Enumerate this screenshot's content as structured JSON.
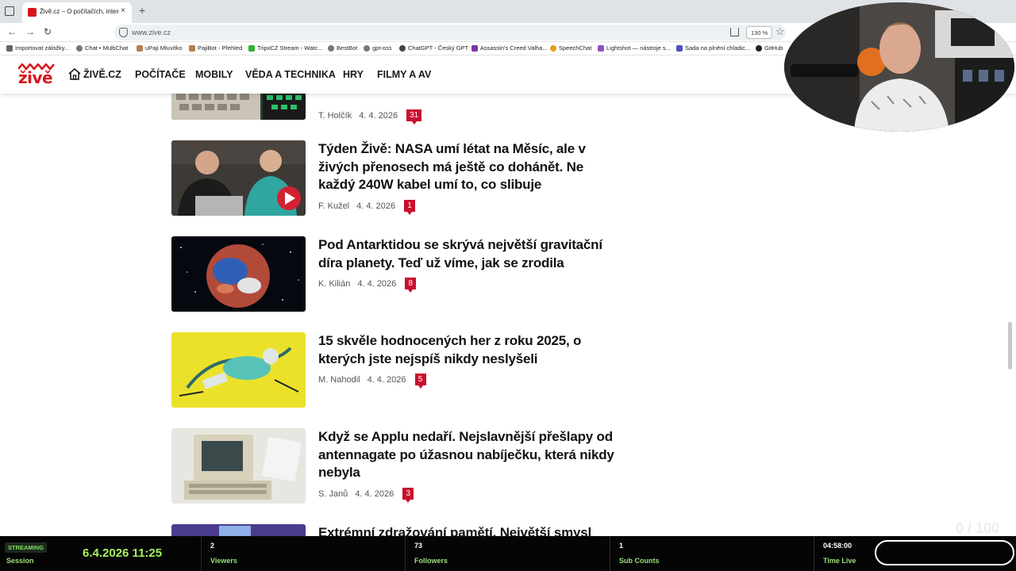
{
  "browser": {
    "tab_title": "Živě.cz – O počítačích, internetu…",
    "tab_close": "×",
    "new_tab": "+",
    "url": "www.zive.cz",
    "zoom": "130 %"
  },
  "bookmarks": [
    "Importovat záložky...",
    "Chat • MultiChat",
    "uPaji Mluvítko",
    "PajiBot - Přehled",
    "TripxCZ Stream - Watc...",
    "BestBot",
    "gpt-oss",
    "ChatGPT - Český GPT",
    "Assassin's Creed Valha...",
    "SpeechChat",
    "Lightshot — nástroje s...",
    "Sada na plnění chladic...",
    "GitHub"
  ],
  "site": {
    "logo_text": "živě",
    "nav": [
      "ŽIVĚ.CZ",
      "POČÍTAČE",
      "MOBILY",
      "VĚDA A TECHNIKA",
      "HRY",
      "FILMY A AV"
    ]
  },
  "articles": [
    {
      "title": "",
      "author": "T. Holčík",
      "date": "4. 4. 2026",
      "comments": "31"
    },
    {
      "title": "Týden Živě: NASA umí létat na Měsíc, ale v živých přenosech má ještě co dohánět. Ne každý 240W kabel umí to, co slibuje",
      "author": "F. Kužel",
      "date": "4. 4. 2026",
      "comments": "1"
    },
    {
      "title": "Pod Antarktidou se skrývá největší gravitační díra planety. Teď už víme, jak se zrodila",
      "author": "K. Kilián",
      "date": "4. 4. 2026",
      "comments": "8"
    },
    {
      "title": "15 skvěle hodnocených her z roku 2025, o kterých jste nejspíš nikdy neslyšeli",
      "author": "M. Nahodil",
      "date": "4. 4. 2026",
      "comments": "5"
    },
    {
      "title": "Když se Applu nedaří. Nejslavnější přešlapy od antennagate po úžasnou nabíječku, která nikdy nebyla",
      "author": "S. Janů",
      "date": "4. 4. 2026",
      "comments": "3"
    },
    {
      "title": "Extrémní zdražování pamětí. Největší smysl"
    }
  ],
  "overlay": {
    "page_counter": "0 / 100"
  },
  "stream": {
    "status": "STREAMING",
    "session_label": "Session",
    "datetime": "6.4.2026 11:25",
    "viewers": "2",
    "viewers_label": "Viewers",
    "followers": "73",
    "followers_label": "Followers",
    "subs": "1",
    "subs_label": "Sub Counts",
    "time_live": "04:58:00",
    "time_live_label": "Time Live"
  },
  "colors": {
    "brand_red": "#d7141a",
    "badge_red": "#c8102e",
    "stream_green": "#a6f25e"
  }
}
